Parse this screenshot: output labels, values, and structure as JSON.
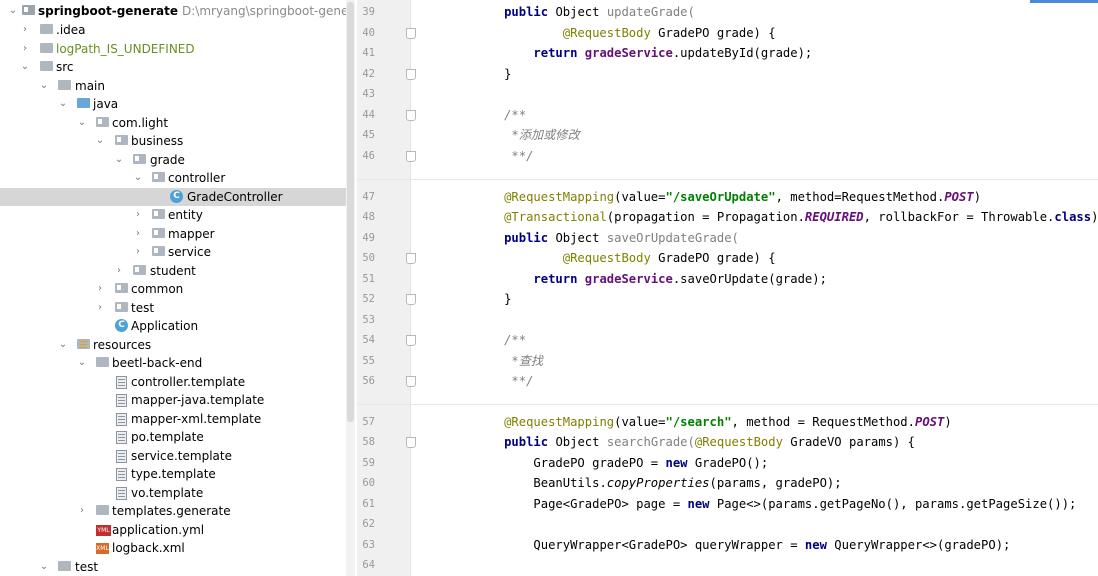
{
  "tree": {
    "rows": [
      {
        "label": "springboot-generate",
        "path": "D:\\mryang\\springboot-generate"
      },
      {
        "label": ".idea"
      },
      {
        "label": "logPath_IS_UNDEFINED"
      },
      {
        "label": "src"
      },
      {
        "label": "main"
      },
      {
        "label": "java"
      },
      {
        "label": "com.light"
      },
      {
        "label": "business"
      },
      {
        "label": "grade"
      },
      {
        "label": "controller"
      },
      {
        "label": "GradeController"
      },
      {
        "label": "entity"
      },
      {
        "label": "mapper"
      },
      {
        "label": "service"
      },
      {
        "label": "student"
      },
      {
        "label": "common"
      },
      {
        "label": "test"
      },
      {
        "label": "Application"
      },
      {
        "label": "resources"
      },
      {
        "label": "beetl-back-end"
      },
      {
        "label": "controller.template"
      },
      {
        "label": "mapper-java.template"
      },
      {
        "label": "mapper-xml.template"
      },
      {
        "label": "po.template"
      },
      {
        "label": "service.template"
      },
      {
        "label": "type.template"
      },
      {
        "label": "vo.template"
      },
      {
        "label": "templates.generate"
      },
      {
        "label": "application.yml"
      },
      {
        "label": "logback.xml"
      },
      {
        "label": "test"
      }
    ],
    "icon_text": {
      "class": "C",
      "yml": "YML",
      "xml": "XML"
    }
  },
  "editor": {
    "line_numbers": [
      "39",
      "40",
      "41",
      "42",
      "43",
      "44",
      "45",
      "46",
      "47",
      "48",
      "49",
      "50",
      "51",
      "52",
      "53",
      "54",
      "55",
      "56",
      "57",
      "58",
      "59",
      "60",
      "61",
      "62",
      "63",
      "64"
    ],
    "code": {
      "l39": [
        "public",
        "Object",
        "updateGrade("
      ],
      "l40": [
        "@RequestBody",
        "GradePO grade) {"
      ],
      "l41": [
        "return",
        "gradeService",
        ".updateById(grade);"
      ],
      "l42": "}",
      "l44": "/**",
      "l45": "*添加或修改",
      "l46": "**/",
      "l47": [
        "@RequestMapping",
        "(value=",
        "\"/saveOrUpdate\"",
        ", method=RequestMethod.",
        "POST",
        ")"
      ],
      "l48": [
        "@Transactional",
        "(propagation = Propagation.",
        "REQUIRED",
        ", rollbackFor = Throwable.",
        "class",
        ")"
      ],
      "l49": [
        "public",
        "Object",
        "saveOrUpdateGrade("
      ],
      "l50": [
        "@RequestBody",
        "GradePO grade) {"
      ],
      "l51": [
        "return",
        "gradeService",
        ".saveOrUpdate(grade);"
      ],
      "l52": "}",
      "l54": "/**",
      "l55": "*查找",
      "l56": "**/",
      "l57": [
        "@RequestMapping",
        "(value=",
        "\"/search\"",
        ", method = RequestMethod.",
        "POST",
        ")"
      ],
      "l58": [
        "public",
        "Object",
        "searchGrade(",
        "@RequestBody",
        "GradeVO params) {"
      ],
      "l59": [
        "GradePO gradePO = ",
        "new",
        "GradePO();"
      ],
      "l60": [
        "BeanUtils.",
        "copyProperties",
        "(params, gradePO);"
      ],
      "l61": [
        "Page<GradePO> page = ",
        "new",
        "Page<>(params.getPageNo(), params.getPageSize());"
      ],
      "l63": [
        "QueryWrapper<GradePO> queryWrapper = ",
        "new",
        "QueryWrapper<>(gradePO);"
      ]
    }
  }
}
